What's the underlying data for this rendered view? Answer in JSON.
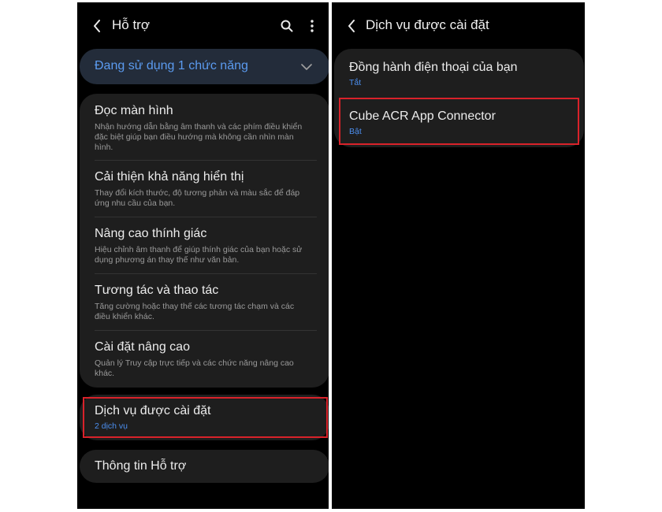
{
  "left": {
    "header": {
      "title": "Hỗ trợ"
    },
    "in_use": {
      "label": "Đang sử dụng 1 chức năng"
    },
    "items": [
      {
        "title": "Đọc màn hình",
        "desc": "Nhận hướng dẫn bằng âm thanh và các phím điều khiển đặc biệt giúp bạn điều hướng mà không cần nhìn màn hình."
      },
      {
        "title": "Cải thiện khả năng hiển thị",
        "desc": "Thay đổi kích thước, độ tương phản và màu sắc để đáp ứng nhu cầu của bạn."
      },
      {
        "title": "Nâng cao thính giác",
        "desc": "Hiệu chỉnh âm thanh để giúp thính giác của bạn hoặc sử dụng phương án thay thế như văn bản."
      },
      {
        "title": "Tương tác và thao tác",
        "desc": "Tăng cường hoặc thay thế các tương tác chạm và các điều khiển khác."
      },
      {
        "title": "Cài đặt nâng cao",
        "desc": "Quản lý Truy cập trực tiếp và các chức năng nâng cao khác."
      }
    ],
    "installed_services": {
      "title": "Dịch vụ được cài đặt",
      "sub": "2 dịch vụ"
    },
    "about": {
      "title": "Thông tin Hỗ trợ"
    }
  },
  "right": {
    "header": {
      "title": "Dịch vụ được cài đặt"
    },
    "services": [
      {
        "title": "Đồng hành điện thoại của bạn",
        "status": "Tắt"
      },
      {
        "title": "Cube ACR App Connector",
        "status": "Bật"
      }
    ]
  },
  "colors": {
    "background": "#000000",
    "card": "#1e1e1e",
    "accent_blue": "#4c8ff0",
    "highlight_red": "#d9222a",
    "in_use_card": "#232c3a"
  },
  "icons": [
    "back-arrow-icon",
    "search-icon",
    "more-options-icon",
    "chevron-down-icon"
  ]
}
